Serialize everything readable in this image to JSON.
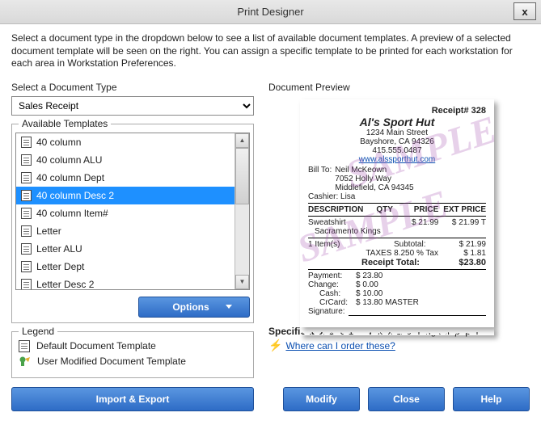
{
  "window": {
    "title": "Print Designer",
    "close": "x"
  },
  "intro": "Select a document type in the dropdown below to see a list of available document templates. A preview of a selected document template will be seen on the right. You can assign a specific template to be printed for each workstation for each area in Workstation Preferences.",
  "doctype": {
    "label": "Select a Document Type",
    "value": "Sales Receipt"
  },
  "templates": {
    "label": "Available Templates",
    "items": [
      "40 column",
      "40 column ALU",
      "40 column Dept",
      "40 column Desc 2",
      "40 column Item#",
      "Letter",
      "Letter ALU",
      "Letter Dept",
      "Letter Desc 2"
    ],
    "selected_index": 3,
    "options_label": "Options"
  },
  "legend": {
    "label": "Legend",
    "default": "Default Document Template",
    "modified": "User Modified Document Template"
  },
  "preview": {
    "label": "Document Preview",
    "receipt_no": "Receipt# 328",
    "store": "Al's Sport Hut",
    "addr1": "1234 Main Street",
    "addr2": "Bayshore, CA 94326",
    "phone": "415.555.0487",
    "url": "www.alssporthut.com",
    "billto_label": "Bill To:",
    "billto_name": "Neil McKeown",
    "billto_addr1": "7052 Holly Way",
    "billto_addr2": "Middlefield, CA 94345",
    "cashier": "Cashier: Lisa",
    "col1": "DESCRIPTION",
    "col2": "QTY",
    "col3": "PRICE",
    "col4": "EXT PRICE",
    "item_name": "Sweatshirt",
    "item_desc": "Sacramento Kings",
    "item_price": "$ 21.99",
    "item_ext": "$ 21.99 T",
    "items_count": "1 Item(s)",
    "subtotal_l": "Subtotal:",
    "subtotal_v": "$ 21.99",
    "tax_l": "TAXES 8.250 % Tax",
    "tax_v": "$ 1.81",
    "total_l": "Receipt Total:",
    "total_v": "$23.80",
    "pay_l": "Payment:",
    "pay_v": "$ 23.80",
    "change_l": "Change:",
    "change_v": "$ 0.00",
    "cash_l": "Cash:",
    "cash_v": "$ 10.00",
    "cc_l": "CrCard:",
    "cc_v": "$ 13.80 MASTER",
    "sig": "Signature:",
    "watermark": "SAMPLE"
  },
  "spec": {
    "label": "Specifications:",
    "value": " 3.15\" wide x 220\" long roll paper.",
    "order": "Where can I order these?"
  },
  "buttons": {
    "import_export": "Import & Export",
    "modify": "Modify",
    "close": "Close",
    "help": "Help"
  }
}
